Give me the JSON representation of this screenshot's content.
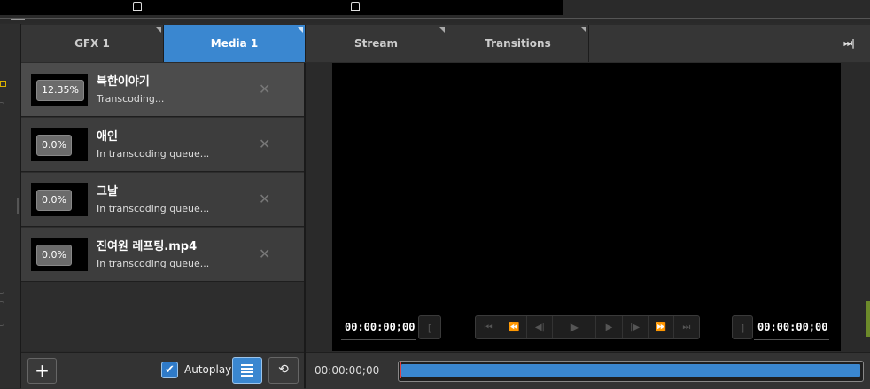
{
  "tabs": [
    {
      "label": "GFX 1",
      "active": false
    },
    {
      "label": "Media 1",
      "active": true
    },
    {
      "label": "Stream",
      "active": false
    },
    {
      "label": "Transitions",
      "active": false
    }
  ],
  "collapse_glyph": "⏭|",
  "media_items": [
    {
      "name": "북한이야기",
      "status": "Transcoding...",
      "progress": "12.35%",
      "progress_fraction": 0.1235,
      "active": true
    },
    {
      "name": "애인",
      "status": "In transcoding queue...",
      "progress": "0.0%",
      "progress_fraction": 0.0,
      "active": false
    },
    {
      "name": "그날",
      "status": "In transcoding queue...",
      "progress": "0.0%",
      "progress_fraction": 0.0,
      "active": false
    },
    {
      "name": "진여원 레프팅.mp4",
      "status": "In transcoding queue...",
      "progress": "0.0%",
      "progress_fraction": 0.0,
      "active": false
    }
  ],
  "remove_glyph": "✕",
  "list_toolbar": {
    "add_glyph": "+",
    "autoplay_label": "Autoplay",
    "autoplay_checked": true,
    "check_glyph": "✔",
    "loop_glyph": "⟲"
  },
  "player": {
    "in_timecode": "00:00:00;00",
    "out_timecode": "00:00:00;00",
    "current_time": "00:00:00;00",
    "scrub_fraction": 1.0,
    "mark_in_glyph": "[",
    "mark_out_glyph": "]",
    "transport": [
      "⏮",
      "⏪",
      "◀|",
      "▶",
      "▶",
      "|▶",
      "⏩",
      "⏭"
    ]
  },
  "colors": {
    "accent": "#3a87d0",
    "panel": "#363636",
    "video_bg": "#000000"
  }
}
